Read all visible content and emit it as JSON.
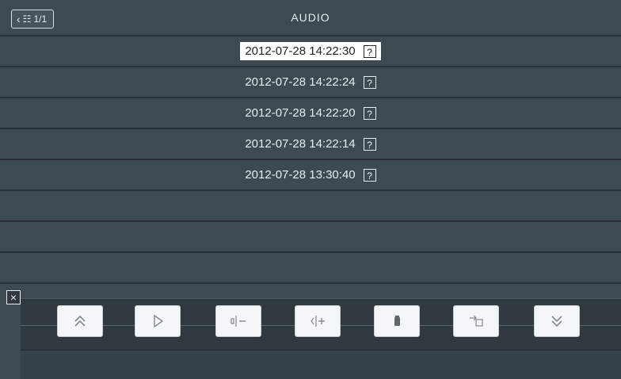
{
  "header": {
    "back_label": "1/1",
    "title": "AUDIO"
  },
  "recordings": [
    {
      "timestamp": "2012-07-28 14:22:30",
      "status_icon": "?",
      "selected": true
    },
    {
      "timestamp": "2012-07-28 14:22:24",
      "status_icon": "?",
      "selected": false
    },
    {
      "timestamp": "2012-07-28 14:22:20",
      "status_icon": "?",
      "selected": false
    },
    {
      "timestamp": "2012-07-28 14:22:14",
      "status_icon": "?",
      "selected": false
    },
    {
      "timestamp": "2012-07-28 13:30:40",
      "status_icon": "?",
      "selected": false
    }
  ],
  "toolbar": {
    "close_icon": "close-icon",
    "buttons": [
      {
        "name": "page-up-icon"
      },
      {
        "name": "play-icon"
      },
      {
        "name": "volume-down-icon"
      },
      {
        "name": "volume-up-icon"
      },
      {
        "name": "delete-icon"
      },
      {
        "name": "export-icon"
      },
      {
        "name": "page-down-icon"
      }
    ]
  },
  "colors": {
    "background": "#3d4a52",
    "selected_bg": "#ffffff",
    "text": "#e8edef"
  }
}
